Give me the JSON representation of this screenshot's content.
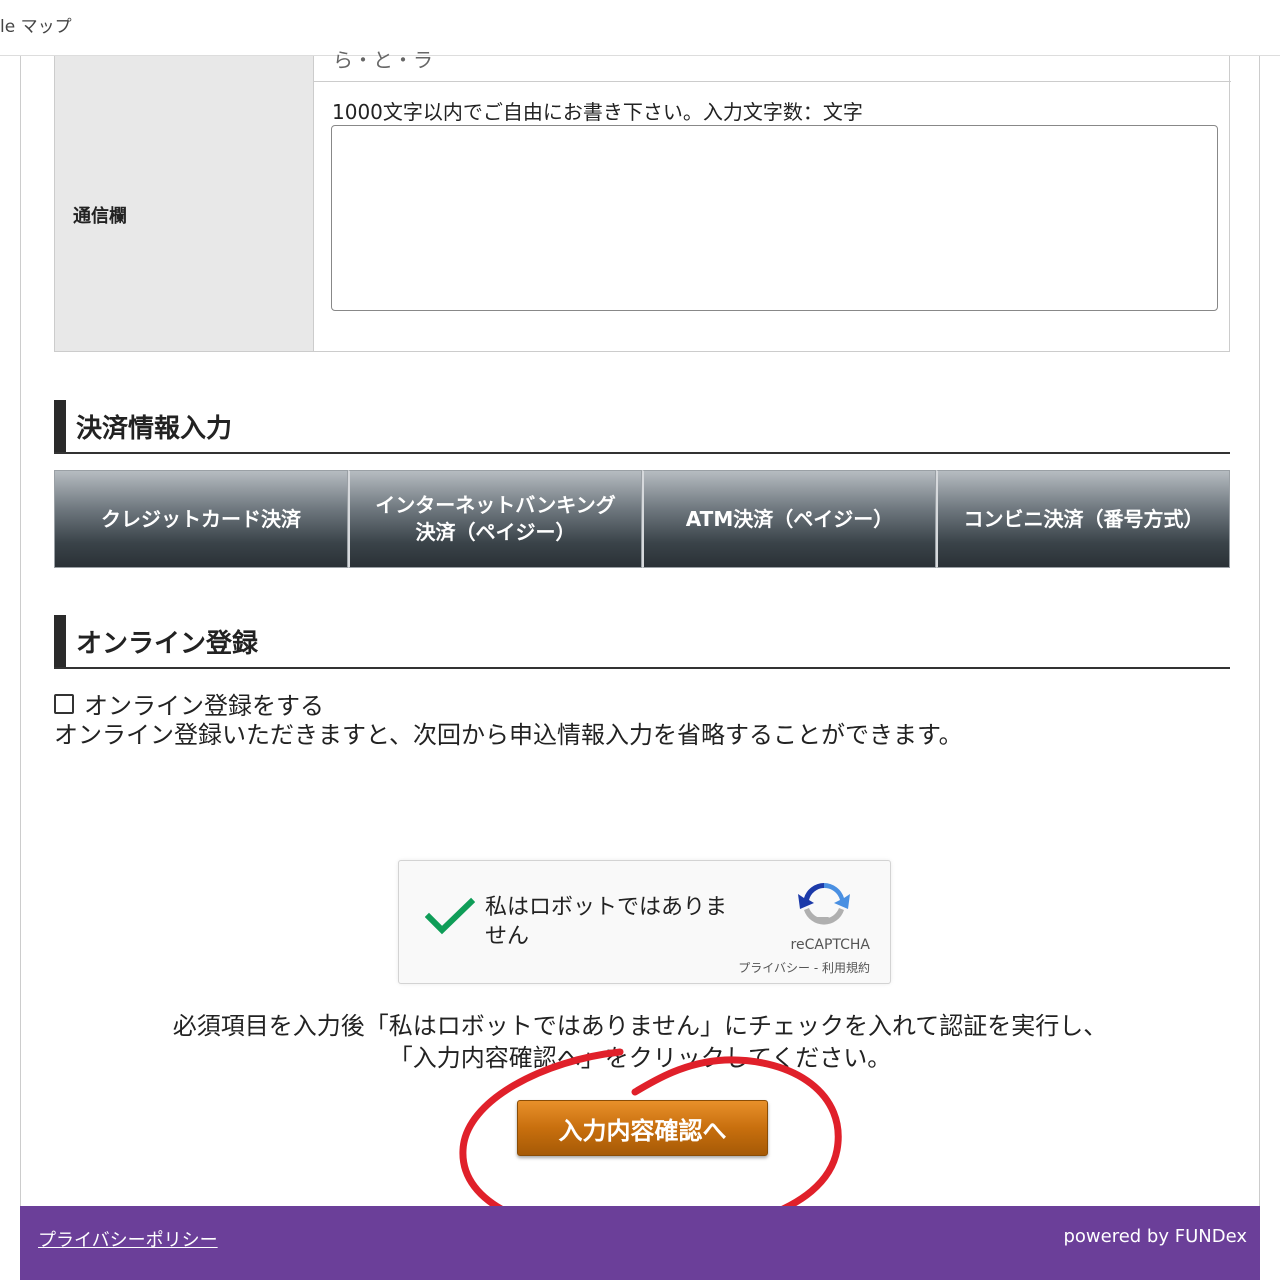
{
  "browser": {
    "tab_label": "le マップ"
  },
  "form": {
    "prev_row_partial": "ら・と・ラ",
    "message_row": {
      "label": "通信欄",
      "hint": "1000文字以内でご自由にお書き下さい。入力文字数：文字",
      "value": ""
    }
  },
  "payment": {
    "heading": "決済情報入力",
    "tabs": [
      {
        "label_line1": "クレジットカード決済",
        "label_line2": ""
      },
      {
        "label_line1": "インターネットバンキング",
        "label_line2": "決済（ペイジー）"
      },
      {
        "label_line1": "ATM決済（ペイジー）",
        "label_line2": ""
      },
      {
        "label_line1": "コンビニ決済（番号方式）",
        "label_line2": ""
      }
    ]
  },
  "online": {
    "heading": "オンライン登録",
    "checkbox_label": "オンライン登録をする",
    "checked": false,
    "note": "オンライン登録いただきますと、次回から申込情報入力を省略することができます。"
  },
  "recaptcha": {
    "text": "私はロボットではありません",
    "brand": "reCAPTCHA",
    "links": "プライバシー - 利用規約",
    "verified": true,
    "check_color": "#0f9d58"
  },
  "instructions": {
    "line1": "必須項目を入力後「私はロボットではありません」にチェックを入れて認証を実行し、",
    "line2": "「入力内容確認へ」をクリックしてください。"
  },
  "submit": {
    "label": "入力内容確認へ",
    "color": "#c86f0e"
  },
  "annotation": {
    "color": "#e0202a"
  },
  "footer": {
    "privacy_link": "プライバシーポリシー",
    "powered_by": "powered by FUNDex",
    "background": "#6b3f99"
  }
}
